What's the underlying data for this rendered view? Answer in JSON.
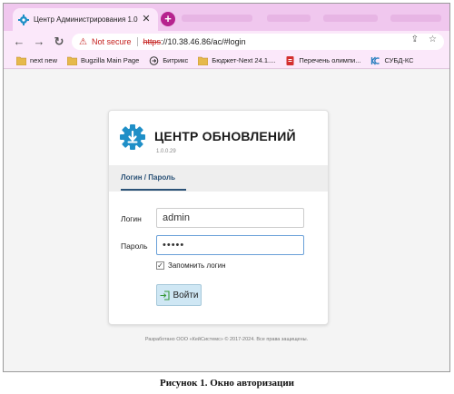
{
  "browser": {
    "tab": {
      "title": "Центр Администрирования 1.0",
      "close": "✕"
    },
    "new_tab": "+",
    "nav": {
      "back": "←",
      "forward": "→",
      "reload": "↻"
    },
    "address": {
      "warning_icon": "warning-icon",
      "security_label": "Not secure",
      "protocol": "https",
      "url_rest": "://10.38.46.86/ac/#login"
    },
    "bookmarks": [
      {
        "label": "next new",
        "icon": "folder-icon"
      },
      {
        "label": "Bugzilla Main Page",
        "icon": "folder-icon"
      },
      {
        "label": "Битрикс",
        "icon": "arrow-circle-icon"
      },
      {
        "label": "Бюджет-Next 24.1....",
        "icon": "folder-icon"
      },
      {
        "label": "Перечень олимпи...",
        "icon": "red-document-icon"
      },
      {
        "label": "СУБД-КС",
        "icon": "ks-logo-icon"
      }
    ]
  },
  "login": {
    "brand": "ЦЕНТР ОБНОВЛЕНИЙ",
    "version": "1.0.0.29",
    "tab_label": "Логин / Пароль",
    "username_label": "Логин",
    "username_value": "admin",
    "password_label": "Пароль",
    "password_value": "•••••",
    "remember_label": "Запомнить логин",
    "remember_checked": true,
    "submit_label": "Войти",
    "footer": "Разработано ООО «КейСистемс» © 2017-2024. Все права защищены."
  },
  "caption": "Рисунок 1. Окно авторизации",
  "colors": {
    "accent": "#2b5277",
    "logo_blue": "#1f8fc7",
    "tab_strip": "#f0c7ee",
    "toolbar": "#fbe8fa",
    "button_bg": "#cfe7f4"
  }
}
